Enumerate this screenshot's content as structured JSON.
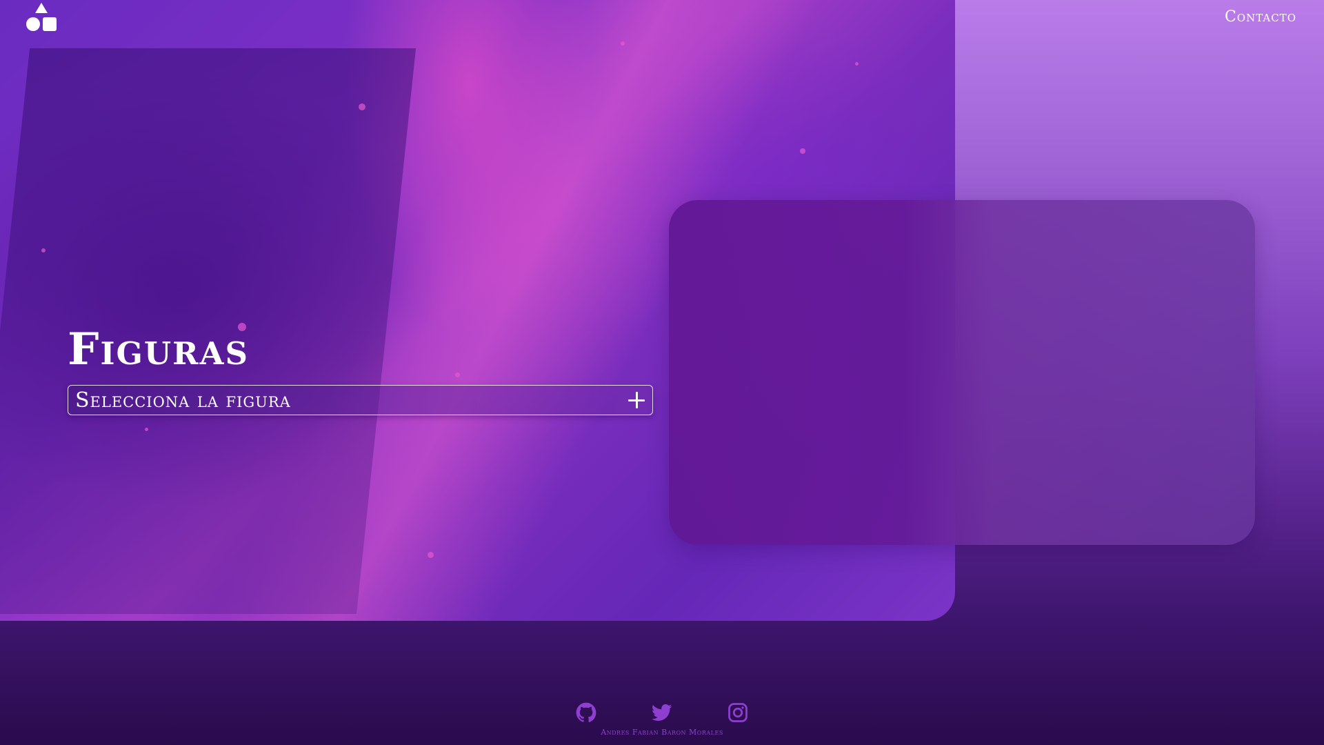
{
  "header": {
    "logo_icon": "shapes-icon",
    "nav": {
      "contact_label": "Contacto"
    }
  },
  "main": {
    "title": "Figuras",
    "selector": {
      "label": "Selecciona la figura",
      "icon": "plus-icon"
    }
  },
  "footer": {
    "social": [
      {
        "name": "github-icon"
      },
      {
        "name": "twitter-icon"
      },
      {
        "name": "instagram-icon"
      }
    ],
    "credit": "Andres Fabian Baron Morales"
  },
  "colors": {
    "accent": "#8e3fd0",
    "card": "#621896",
    "text": "#ffffff"
  }
}
